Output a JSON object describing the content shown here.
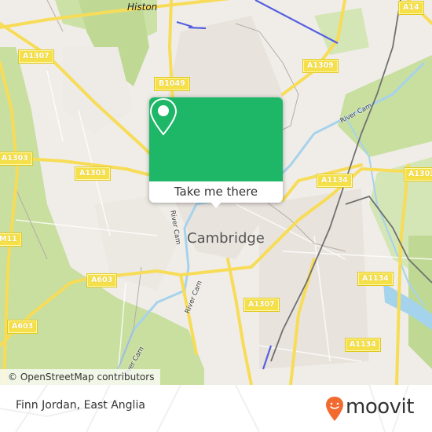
{
  "map": {
    "place_labels": {
      "histon": "Histon",
      "cambridge": "Cambridge"
    },
    "road_labels": {
      "a1307_nw": "A1307",
      "b1049": "B1049",
      "a1309": "A1309",
      "a14": "A14",
      "a1303_w": "A1303",
      "a1303_mid": "A1303",
      "a1303_e": "A1303",
      "a1134_n": "A1134",
      "a1134_e": "A1134",
      "a1134_se": "A1134",
      "m11": "M11",
      "a603_mid": "A603",
      "a603_sw": "A603",
      "a1307_s": "A1307"
    },
    "river_labels": {
      "river_cam_ne": "River Cam",
      "river_cam_center": "River Cam",
      "river_cam_south": "River Cam",
      "river_cam_sw": "River Cam"
    },
    "colors": {
      "road": "#f7dc58",
      "park": "#c8df9f",
      "water": "#a6d3ec",
      "urban": "#e8e2dc",
      "railway": "#707070",
      "guided_busway": "#5560e0"
    },
    "attribution": "© OpenStreetMap contributors"
  },
  "popup": {
    "icon": "map-pin-icon",
    "button_label": "Take me there",
    "accent_color": "#1db767"
  },
  "footer": {
    "title": "Finn Jordan, East Anglia",
    "brand": "moovit",
    "brand_color": "#f26a30"
  }
}
